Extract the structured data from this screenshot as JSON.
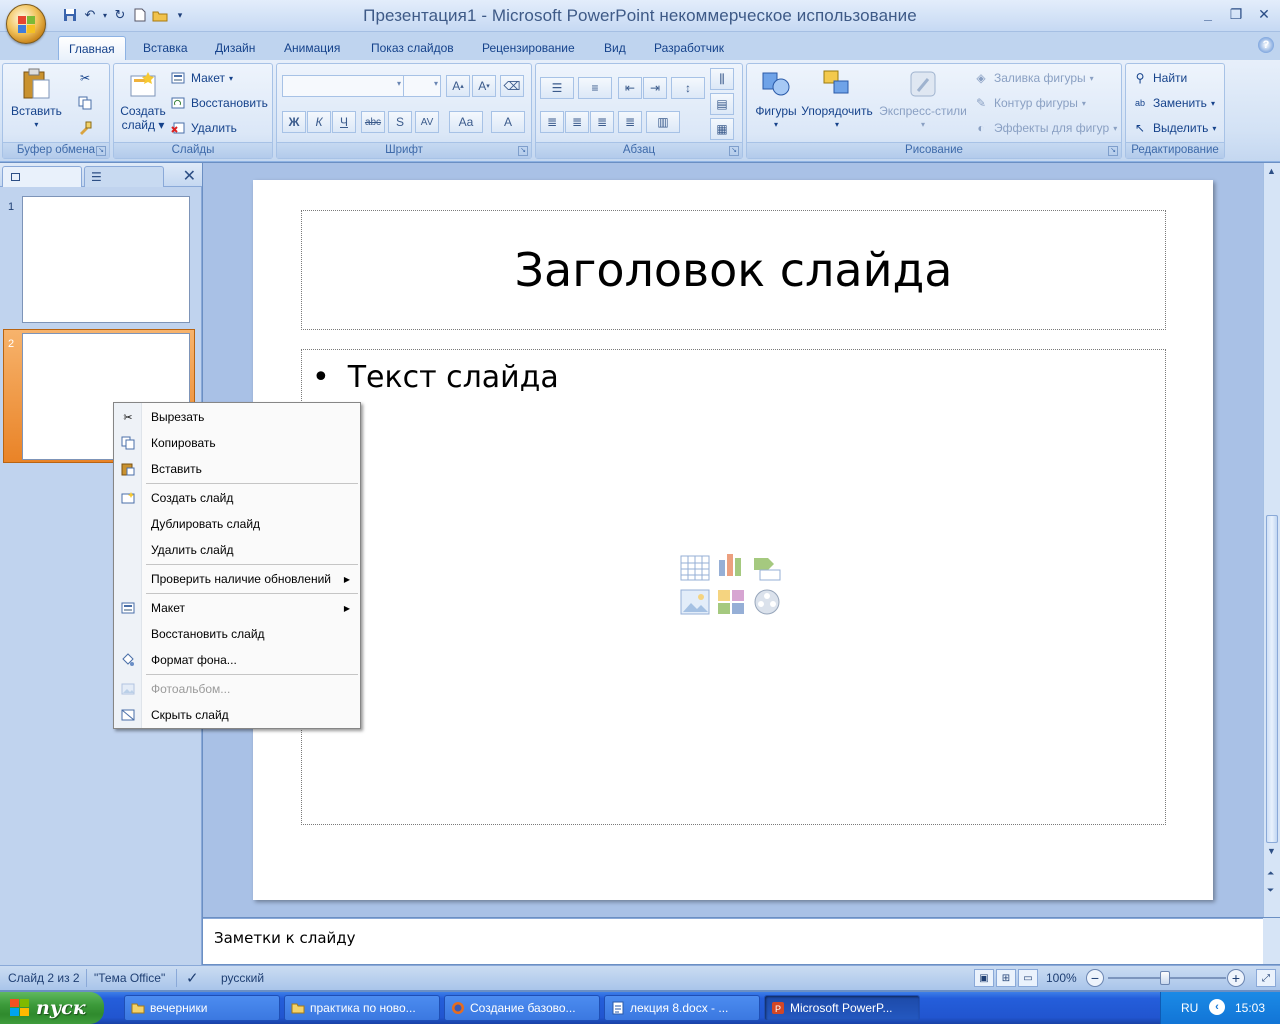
{
  "window": {
    "title": "Презентация1 - Microsoft PowerPoint некоммерческое использование"
  },
  "tabs": [
    "Главная",
    "Вставка",
    "Дизайн",
    "Анимация",
    "Показ слайдов",
    "Рецензирование",
    "Вид",
    "Разработчик"
  ],
  "ribbon": {
    "clipboard": {
      "paste": "Вставить",
      "label": "Буфер обмена"
    },
    "slides": {
      "create_line1": "Создать",
      "create_line2": "слайд",
      "layout": "Макет",
      "reset": "Восстановить",
      "delete": "Удалить",
      "label": "Слайды"
    },
    "font": {
      "label": "Шрифт",
      "bold": "Ж",
      "italic": "К",
      "underline": "Ч",
      "strike": "abc",
      "shadow": "S",
      "spacing": "AV",
      "case": "Aa",
      "color": "A"
    },
    "paragraph": {
      "label": "Абзац"
    },
    "drawing": {
      "shapes": "Фигуры",
      "arrange": "Упорядочить",
      "styles": "Экспресс-стили",
      "fill": "Заливка фигуры",
      "outline": "Контур фигуры",
      "effects": "Эффекты для фигур",
      "label": "Рисование"
    },
    "editing": {
      "find": "Найти",
      "replace": "Заменить",
      "select": "Выделить",
      "label": "Редактирование"
    }
  },
  "thumbnails": [
    "1",
    "2"
  ],
  "slide": {
    "title": "Заголовок слайда",
    "body": "Текст слайда"
  },
  "notes": "Заметки к слайду",
  "status": {
    "slide": "Слайд 2 из 2",
    "theme": "\"Тема Office\"",
    "language": "русский",
    "zoom": "100%"
  },
  "context_menu": [
    {
      "label": "Вырезать",
      "icon": "scissors-icon"
    },
    {
      "label": "Копировать",
      "icon": "copy-icon"
    },
    {
      "label": "Вставить",
      "icon": "paste-icon"
    },
    {
      "label": "Создать слайд",
      "icon": "new-slide-icon"
    },
    {
      "label": "Дублировать слайд",
      "icon": ""
    },
    {
      "label": "Удалить слайд",
      "icon": ""
    },
    {
      "label": "Проверить наличие обновлений",
      "icon": ""
    },
    {
      "label": "Макет",
      "icon": "layout-icon"
    },
    {
      "label": "Восстановить слайд",
      "icon": ""
    },
    {
      "label": "Формат фона...",
      "icon": "format-background-icon"
    },
    {
      "label": "Фотоальбом...",
      "icon": "photo-album-icon"
    },
    {
      "label": "Скрыть слайд",
      "icon": "hide-slide-icon"
    }
  ],
  "taskbar": {
    "start": "пуск",
    "items": [
      "вечерники",
      "практика по ново...",
      "Создание базово...",
      "лекция 8.docx - ...",
      "Microsoft PowerP..."
    ],
    "lang": "RU",
    "time": "15:03"
  }
}
